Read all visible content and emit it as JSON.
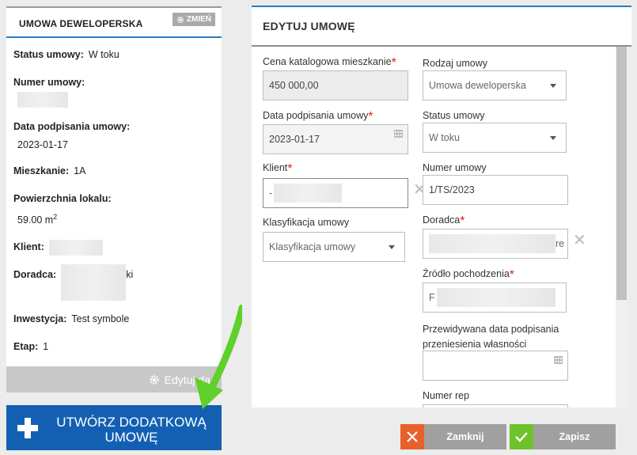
{
  "contract_card": {
    "title": "UMOWA DEWELOPERSKA",
    "change_label": "ZMIEŃ",
    "status_label": "Status umowy:",
    "status_value": "W toku",
    "number_label": "Numer umowy:",
    "signed_label": "Data podpisania umowy:",
    "signed_value": "2023-01-17",
    "unit_label": "Mieszkanie:",
    "unit_value": "1A",
    "area_label": "Powierzchnia lokalu:",
    "area_value": "59.00 m",
    "area_unit_sup": "2",
    "client_label": "Klient:",
    "advisor_label": "Doradca:",
    "advisor_value_tail": "ki",
    "investment_label": "Inwestycja:",
    "investment_value": "Test symbole",
    "stage_label": "Etap:",
    "stage_value": "1",
    "edit_label": "Edytuj da"
  },
  "create_button": {
    "label_line1": "UTWÓRZ DODATKOWĄ",
    "label_line2": "UMOWĘ"
  },
  "modal": {
    "title": "EDYTUJ UMOWĘ",
    "left": {
      "price_label": "Cena katalogowa mieszkanie",
      "price_value": "450 000,00",
      "sign_date_label": "Data podpisania umowy",
      "sign_date_value": "2023-01-17",
      "client_label": "Klient",
      "client_value_start": "-",
      "classification_label": "Klasyfikacja umowy",
      "classification_placeholder": "Klasyfikacja umowy"
    },
    "right": {
      "type_label": "Rodzaj umowy",
      "type_value": "Umowa deweloperska",
      "status_label": "Status umowy",
      "status_value": "W toku",
      "number_label": "Numer umowy",
      "number_value": "1/TS/2023",
      "advisor_label": "Doradca",
      "advisor_value_tail": "re",
      "source_label": "Źródło pochodzenia",
      "source_value_start": "F",
      "transfer_label_line1": "Przewidywana data podpisania",
      "transfer_label_line2": "przeniesienia własności",
      "rep_label": "Numer rep"
    },
    "buttons": {
      "close_label": "Zamknij",
      "save_label": "Zapisz"
    },
    "required_mark": "*"
  },
  "colors": {
    "primary_blue": "#1360b3",
    "accent_blue": "#2a7cc0",
    "required_red": "#e0231a",
    "close_orange": "#e8602c",
    "save_green": "#6fc22b",
    "arrow_green": "#5fd12a"
  }
}
